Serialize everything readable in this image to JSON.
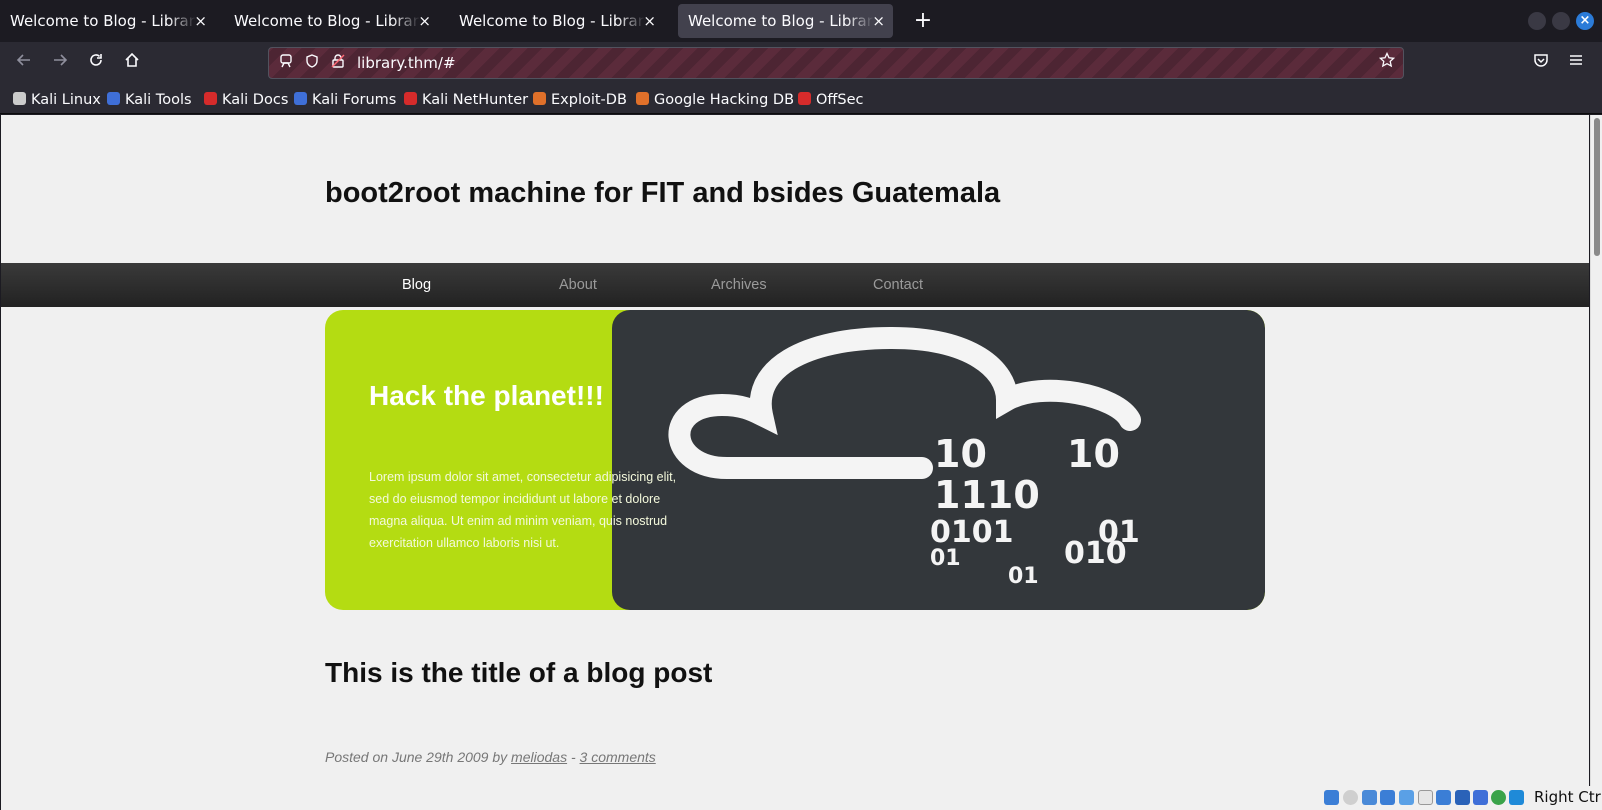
{
  "tabs": [
    {
      "title": "Welcome to Blog - Library Machine",
      "active": false
    },
    {
      "title": "Welcome to Blog - Library Machine",
      "active": false
    },
    {
      "title": "Welcome to Blog - Library Machine",
      "active": false
    },
    {
      "title": "Welcome to Blog - Library Machine",
      "active": true
    }
  ],
  "tab_close_glyph": "×",
  "new_tab_glyph": "+",
  "window_close_glyph": "×",
  "address": {
    "url": "library.thm/#"
  },
  "bookmarks": [
    {
      "label": "Kali Linux",
      "color": "#cccccc"
    },
    {
      "label": "Kali Tools",
      "color": "#3f6fd8"
    },
    {
      "label": "Kali Docs",
      "color": "#d62b2b"
    },
    {
      "label": "Kali Forums",
      "color": "#3f6fd8"
    },
    {
      "label": "Kali NetHunter",
      "color": "#d62b2b"
    },
    {
      "label": "Exploit-DB",
      "color": "#e0702a"
    },
    {
      "label": "Google Hacking DB",
      "color": "#e0702a"
    },
    {
      "label": "OffSec",
      "color": "#d62b2b"
    }
  ],
  "site": {
    "title": "boot2root machine for FIT and bsides Guatemala",
    "menu": [
      "Blog",
      "About",
      "Archives",
      "Contact"
    ],
    "menu_current": "Blog"
  },
  "hero": {
    "heading": "Hack the planet!!!",
    "text": "Lorem ipsum dolor sit amet, consectetur adipisicing elit, sed do eiusmod tempor incididunt ut labore et dolore magna aliqua. Ut enim ad minim veniam, quis nostrud exercitation ullamco laboris nisi ut.",
    "binary_rows": [
      "10",
      "10",
      "1110",
      "0101",
      "01",
      "01",
      "010",
      "01"
    ],
    "colors": {
      "green": "#b4dc12",
      "dark": "#33373b"
    }
  },
  "post": {
    "title": "This is the title of a blog post",
    "meta_prefix": "Posted on June 29th 2009 by ",
    "author": "meliodas",
    "separator": " - ",
    "comments": "3 comments"
  },
  "vm_tray": {
    "host_key": "Right Ctrl"
  }
}
